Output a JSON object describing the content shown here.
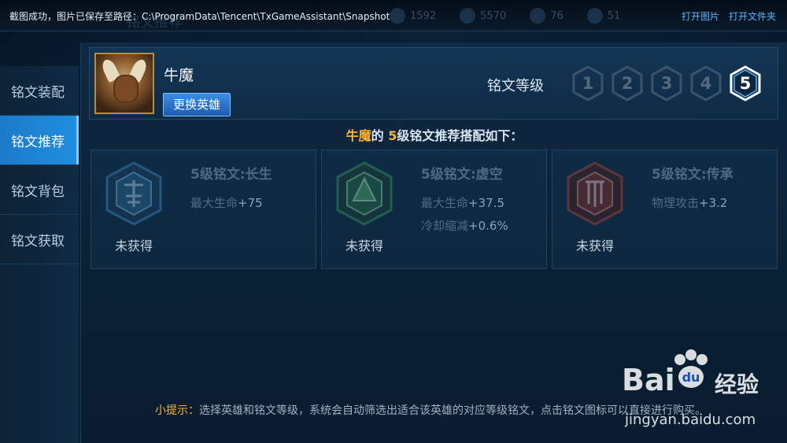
{
  "topbar": {
    "notice": "截图成功，图片已保存至路径：C:\\ProgramData\\Tencent\\TxGameAssistant\\Snapshot",
    "ghost_title": "铭文推荐",
    "stats": [
      "1592",
      "5570",
      "76",
      "51"
    ],
    "open_image": "打开图片",
    "open_folder": "打开文件夹"
  },
  "sidebar": {
    "items": [
      {
        "label": "铭文装配"
      },
      {
        "label": "铭文推荐"
      },
      {
        "label": "铭文背包"
      },
      {
        "label": "铭文获取"
      }
    ],
    "active_index": 1
  },
  "hero": {
    "name": "牛魔",
    "swap_label": "更换英雄"
  },
  "level": {
    "label": "铭文等级",
    "options": [
      "1",
      "2",
      "3",
      "4",
      "5"
    ],
    "selected": "5"
  },
  "recommend": {
    "hero": "牛魔",
    "mid": "的 ",
    "level": "5",
    "suffix": "级铭文推荐搭配如下："
  },
  "cards": [
    {
      "title": "5级铭文:长生",
      "status": "未获得",
      "attrs": [
        {
          "name": "最大生命",
          "value": "+75"
        }
      ],
      "color": "#3d8fc4",
      "icon": "longevity-rune-icon"
    },
    {
      "title": "5级铭文:虚空",
      "status": "未获得",
      "attrs": [
        {
          "name": "最大生命",
          "value": "+37.5"
        },
        {
          "name": "冷却缩减",
          "value": "+0.6%"
        }
      ],
      "color": "#3aa05a",
      "icon": "void-rune-icon"
    },
    {
      "title": "5级铭文:传承",
      "status": "未获得",
      "attrs": [
        {
          "name": "物理攻击",
          "value": "+3.2"
        }
      ],
      "color": "#c0442e",
      "icon": "inheritance-rune-icon"
    }
  ],
  "tip": {
    "label": "小提示：",
    "text": "选择英雄和铭文等级，系统会自动筛选出适合该英雄的对应等级铭文，点击铭文图标可以直接进行购买。"
  },
  "watermark": {
    "logo": "Bai",
    "logo2": "经验",
    "url": "jingyan.baidu.com"
  }
}
